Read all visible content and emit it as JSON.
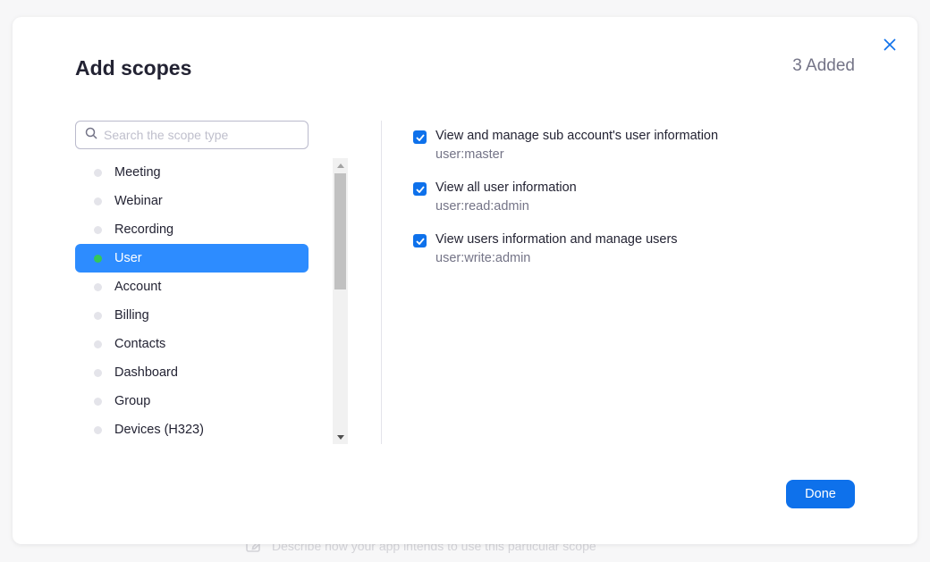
{
  "backdrop": {
    "hint_icon": "edit-icon",
    "hint_text": "Describe how your app intends to use this particular scope"
  },
  "modal": {
    "title": "Add scopes",
    "added_count": "3 Added",
    "close_icon": "close-icon",
    "search": {
      "placeholder": "Search the scope type",
      "value": ""
    },
    "categories": [
      {
        "label": "Meeting",
        "active": false
      },
      {
        "label": "Webinar",
        "active": false
      },
      {
        "label": "Recording",
        "active": false
      },
      {
        "label": "User",
        "active": true
      },
      {
        "label": "Account",
        "active": false
      },
      {
        "label": "Billing",
        "active": false
      },
      {
        "label": "Contacts",
        "active": false
      },
      {
        "label": "Dashboard",
        "active": false
      },
      {
        "label": "Group",
        "active": false
      },
      {
        "label": "Devices (H323)",
        "active": false
      }
    ],
    "scopes": [
      {
        "name": "View and manage sub account's user information",
        "code": "user:master",
        "checked": true
      },
      {
        "name": "View all user information",
        "code": "user:read:admin",
        "checked": true
      },
      {
        "name": "View users information and manage users",
        "code": "user:write:admin",
        "checked": true
      }
    ],
    "done_label": "Done"
  },
  "colors": {
    "accent": "#0e71eb",
    "active_item": "#2d8cff",
    "active_dot": "#34c759"
  }
}
